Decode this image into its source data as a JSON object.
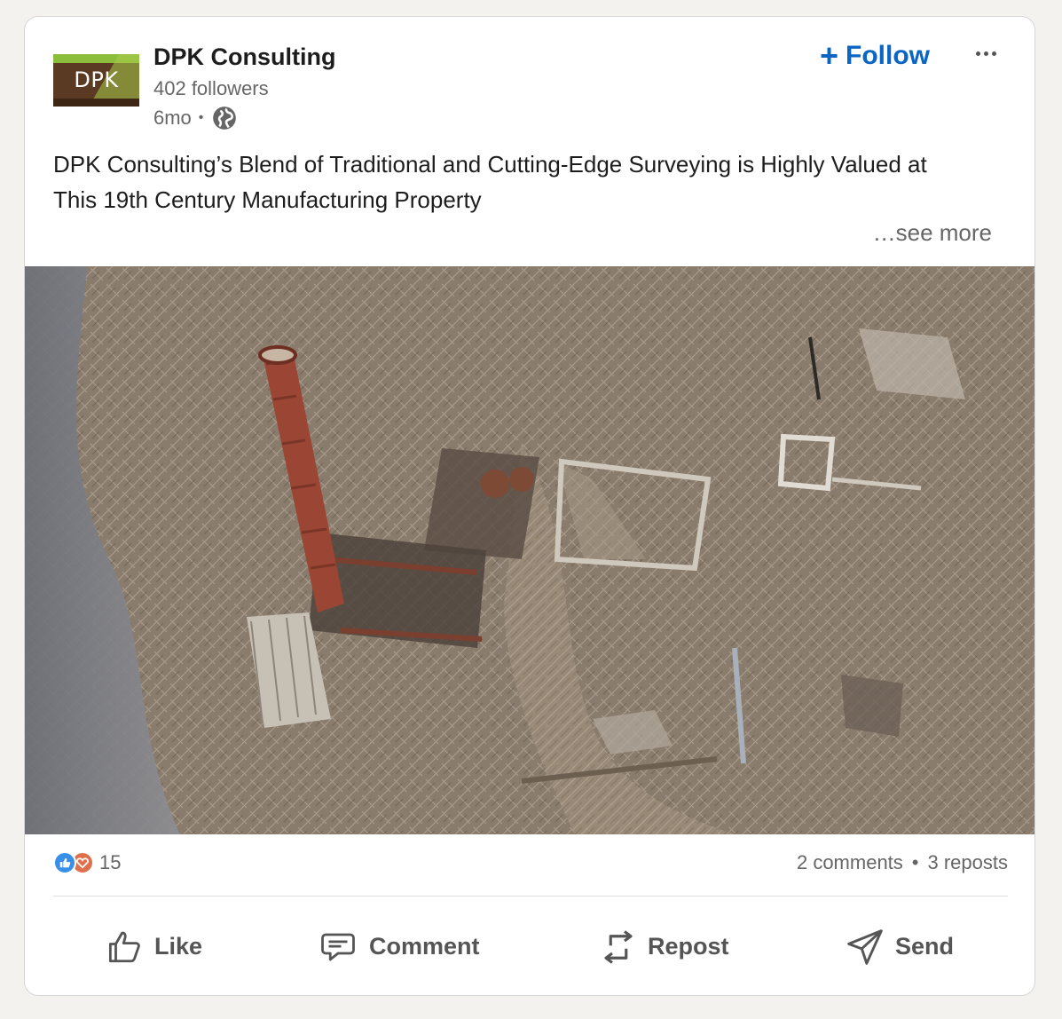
{
  "post": {
    "author": {
      "logo_text": "DPK",
      "name": "DPK Consulting",
      "followers": "402 followers",
      "time": "6mo",
      "visibility_icon": "globe-icon"
    },
    "follow_label": "Follow",
    "more_icon": "more-options-icon",
    "text": "DPK Consulting’s Blend of Traditional and Cutting-Edge Surveying is Highly Valued at This 19th Century Manufacturing Property",
    "see_more": "…see more",
    "image_icon": "aerial-photo"
  },
  "social": {
    "reaction_count": "15",
    "comments": "2 comments",
    "reposts": "3 reposts"
  },
  "actions": {
    "like": "Like",
    "comment": "Comment",
    "repost": "Repost",
    "send": "Send"
  },
  "colors": {
    "accent": "#0a66c2",
    "like_reaction": "#378fe9",
    "love_reaction": "#df704d",
    "logo_green": "#8cbd3a",
    "logo_brown": "#5a3a22"
  }
}
